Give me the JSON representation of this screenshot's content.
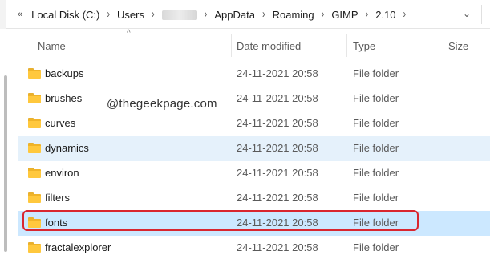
{
  "address": {
    "segments": [
      "Local Disk (C:)",
      "Users",
      "",
      "AppData",
      "Roaming",
      "GIMP",
      "2.10"
    ]
  },
  "columns": {
    "name": "Name",
    "date": "Date modified",
    "type": "Type",
    "size": "Size"
  },
  "rows": [
    {
      "name": "backups",
      "date": "24-11-2021 20:58",
      "type": "File folder"
    },
    {
      "name": "brushes",
      "date": "24-11-2021 20:58",
      "type": "File folder"
    },
    {
      "name": "curves",
      "date": "24-11-2021 20:58",
      "type": "File folder"
    },
    {
      "name": "dynamics",
      "date": "24-11-2021 20:58",
      "type": "File folder"
    },
    {
      "name": "environ",
      "date": "24-11-2021 20:58",
      "type": "File folder"
    },
    {
      "name": "filters",
      "date": "24-11-2021 20:58",
      "type": "File folder"
    },
    {
      "name": "fonts",
      "date": "24-11-2021 20:58",
      "type": "File folder"
    },
    {
      "name": "fractalexplorer",
      "date": "24-11-2021 20:58",
      "type": "File folder"
    }
  ],
  "watermark": "@thegeekpage.com",
  "colors": {
    "hover_row": "#e5f1fb",
    "selected_row": "#cce8ff",
    "highlight_border": "#d9262f",
    "folder": "#ffc83d"
  }
}
